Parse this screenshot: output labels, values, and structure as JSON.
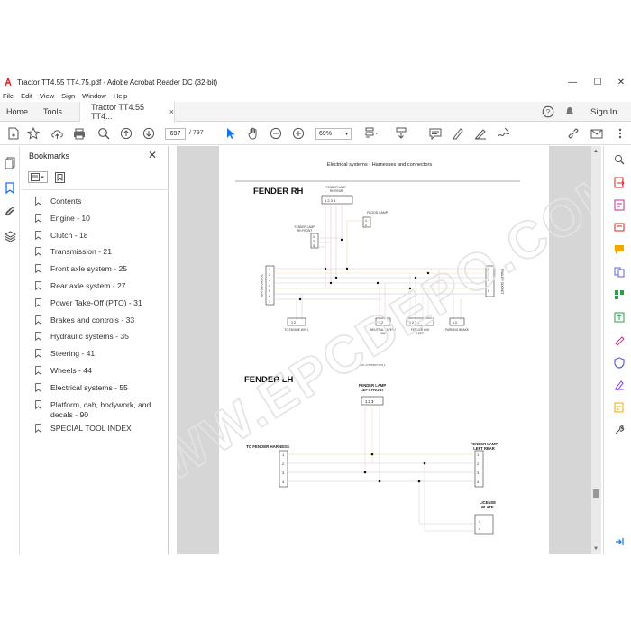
{
  "window": {
    "title": "Tractor TT4.55 TT4.75.pdf - Adobe Acrobat Reader DC (32-bit)",
    "minimize": "—",
    "maximize": "☐",
    "close": "✕"
  },
  "menu": [
    "File",
    "Edit",
    "View",
    "Sign",
    "Window",
    "Help"
  ],
  "tabs": {
    "home": "Home",
    "tools": "Tools",
    "document": "Tractor TT4.55 TT4...",
    "close": "×",
    "signin": "Sign In"
  },
  "toolbar": {
    "page_current": "697",
    "page_sep": "/",
    "page_total": "797",
    "zoom": "69%"
  },
  "bookmarks": {
    "title": "Bookmarks",
    "close": "✕",
    "items": [
      "Contents",
      "Engine - 10",
      "Clutch - 18",
      "Transmission - 21",
      "Front axle system - 25",
      "Rear axle system - 27",
      "Power Take-Off (PTO) - 31",
      "Brakes and controls - 33",
      "Hydraulic systems - 35",
      "Steering - 41",
      "Wheels - 44",
      "Electrical systems - 55",
      "Platform, cab, bodywork, and decals - 90",
      "SPECIAL TOOL INDEX"
    ],
    "selected_index": 11
  },
  "document": {
    "header": "Electrical systems - Harnesses and connectors",
    "rh": {
      "title": "FENDER RH",
      "lamp_rear": "FENDER LAMP\nRH REAR",
      "flood_lamp": "FLOOD LAMP",
      "lamp_front": "FENDER LAMP\nRH FRONT",
      "to_engine": "TO ENGINE W/H",
      "trailer_socket": "TRAILER SOCKET",
      "to_engine_bottom": "TO ENGINE W/H 1",
      "neutral_safety": "NEUTRAL SAFETY\nSW",
      "fender_wh_left": "FENDER W/H\nLEFT",
      "parking_brake": "PARKING BRAKE",
      "ref": "BAIL ATTRIBUTION 1"
    },
    "lh": {
      "title": "FENDER LH",
      "lamp_left_front": "FENDER LAMP\nLEFT FRONT",
      "to_harness": "TO FENDER HARNESS",
      "lamp_left_rear": "FENDER LAMP\nLEFT REAR",
      "license_plate": "LICENSE\nPLATE"
    }
  },
  "watermark": "WWW.EPCDEPO.COM",
  "colors": {
    "accent": "#1473e6",
    "pdf_red": "#d9241c",
    "doc_bg": "#d6d6d6"
  }
}
